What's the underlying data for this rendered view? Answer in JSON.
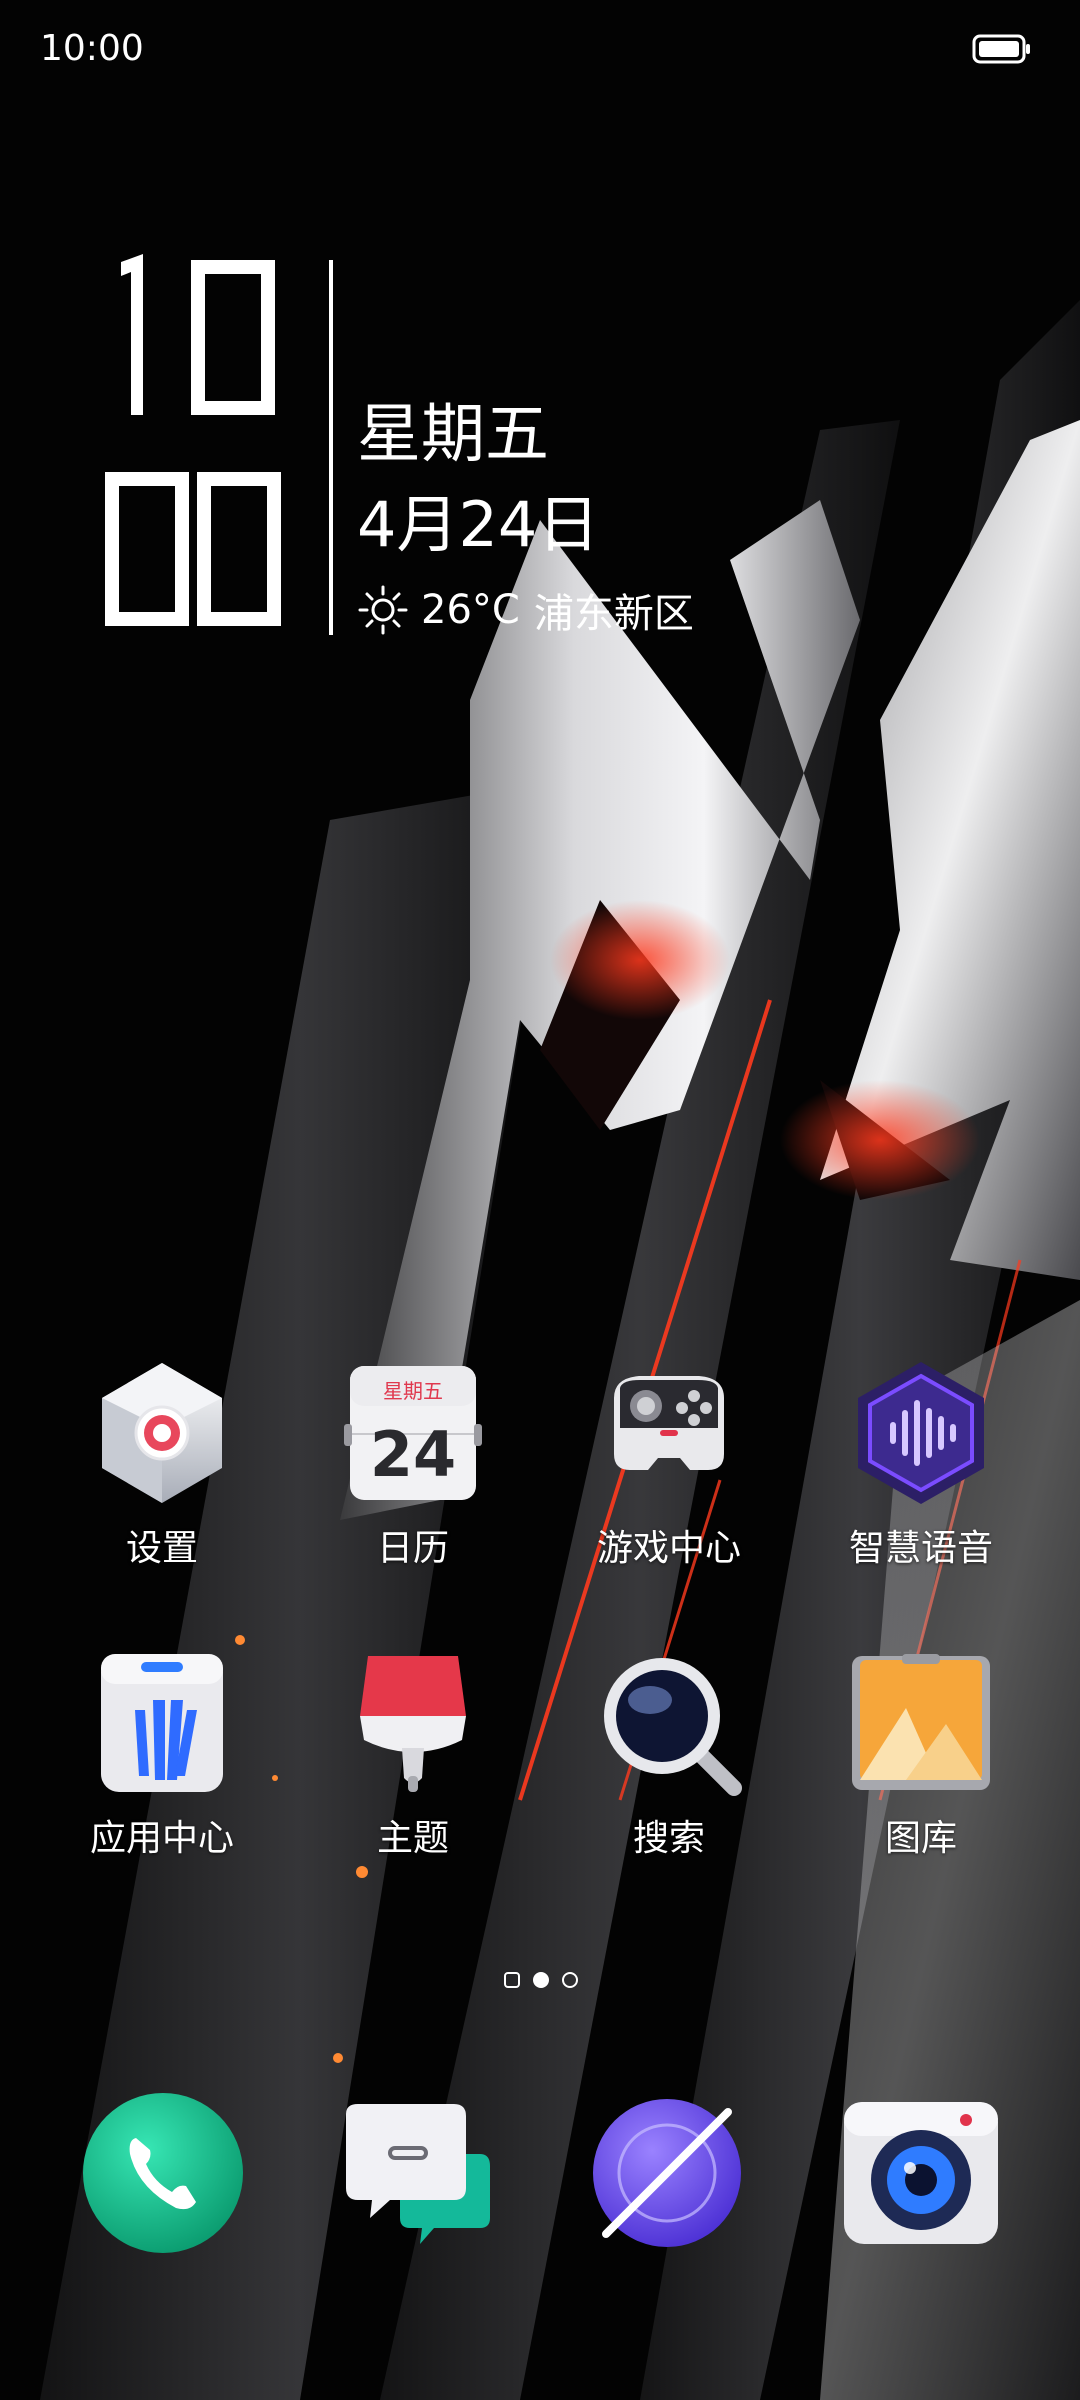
{
  "status_bar": {
    "time": "10:00",
    "battery_icon": "battery-full-icon"
  },
  "clock_widget": {
    "hour": "10",
    "minute": "00",
    "weekday": "星期五",
    "date": "4月24日",
    "weather_icon": "sun-icon",
    "temperature": "26°C",
    "location": "浦东新区"
  },
  "apps": [
    {
      "label": "设置",
      "icon": "settings-icon"
    },
    {
      "label": "日历",
      "icon": "calendar-icon",
      "icon_weekday": "星期五",
      "icon_day": "24"
    },
    {
      "label": "游戏中心",
      "icon": "game-controller-icon"
    },
    {
      "label": "智慧语音",
      "icon": "voice-assistant-icon"
    },
    {
      "label": "应用中心",
      "icon": "app-store-icon"
    },
    {
      "label": "主题",
      "icon": "theme-brush-icon"
    },
    {
      "label": "搜索",
      "icon": "magnifier-icon"
    },
    {
      "label": "图库",
      "icon": "gallery-icon"
    }
  ],
  "page_indicator": {
    "pages": 3,
    "current": 2
  },
  "dock": [
    {
      "icon": "phone-icon"
    },
    {
      "icon": "messages-icon"
    },
    {
      "icon": "browser-icon"
    },
    {
      "icon": "camera-icon"
    }
  ],
  "colors": {
    "accent_red": "#ff3a1e",
    "phone_green": "#1fcf9a",
    "voice_purple": "#7b4cff"
  }
}
